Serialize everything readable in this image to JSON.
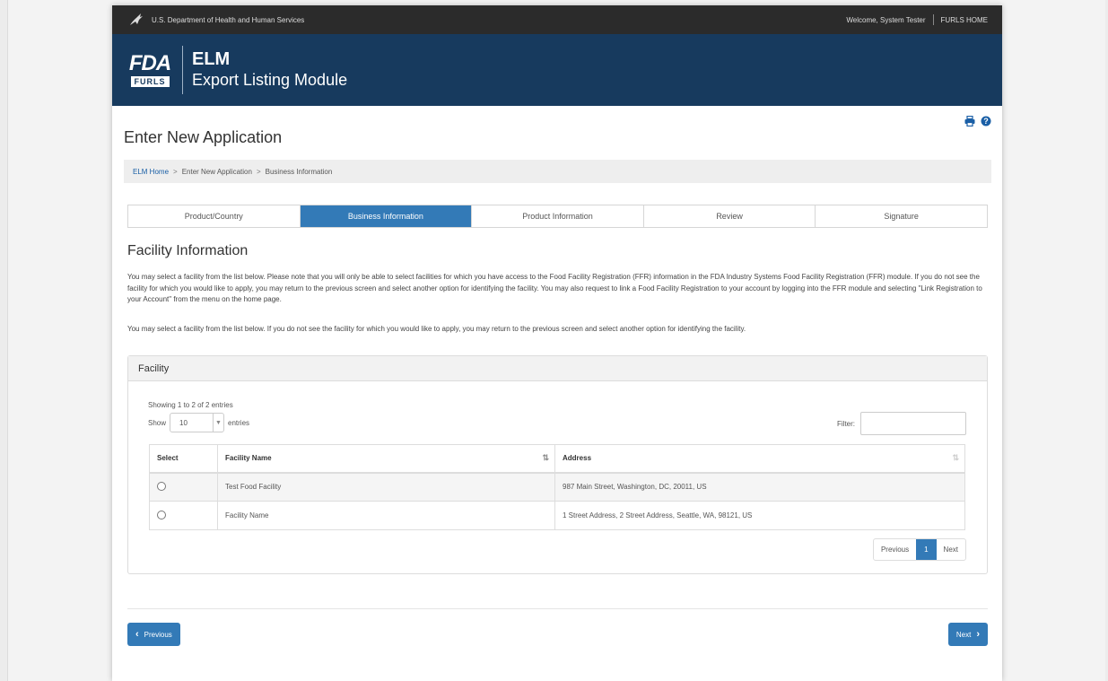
{
  "topbar": {
    "agency": "U.S. Department of Health and Human Services",
    "welcome": "Welcome, System Tester",
    "home_link": "FURLS HOME"
  },
  "banner": {
    "logo_text": "FDA",
    "logo_sub": "FURLS",
    "title": "ELM",
    "subtitle": "Export Listing Module"
  },
  "page_title": "Enter New Application",
  "breadcrumb": {
    "home": "ELM Home",
    "sep": ">",
    "item1": "Enter New Application",
    "item2": "Business Information"
  },
  "steps": [
    {
      "label": "Product/Country"
    },
    {
      "label": "Business Information"
    },
    {
      "label": "Product Information"
    },
    {
      "label": "Review"
    },
    {
      "label": "Signature"
    }
  ],
  "section_title": "Facility Information",
  "para1": "You may select a facility from the list below. Please note that you will only be able to select facilities for which you have access to the Food Facility Registration (FFR) information in the FDA Industry Systems Food Facility Registration (FFR) module. If you do not see the facility for which you would like to apply, you may return to the previous screen and select another option for identifying the facility. You may also request to link a Food Facility Registration to your account by logging into the FFR module and selecting \"Link Registration to your Account\" from the menu on the home page.",
  "para2": "You may select a facility from the list below. If you do not see the facility for which you would like to apply, you may return to the previous screen and select another option for identifying the facility.",
  "panel": {
    "title": "Facility",
    "showing": "Showing 1 to 2 of 2 entries",
    "show_label": "Show",
    "page_length": "10",
    "entries_label": "entries",
    "filter_label": "Filter:",
    "filter_value": ""
  },
  "table": {
    "headers": [
      "Select",
      "Facility Name",
      "Address"
    ],
    "rows": [
      {
        "name": "Test Food Facility",
        "address": "987 Main Street, Washington, DC, 20011, US"
      },
      {
        "name": "Facility Name",
        "address": "1 Street Address, 2 Street Address, Seattle, WA, 98121, US"
      }
    ]
  },
  "pager": {
    "previous": "Previous",
    "page": "1",
    "next": "Next"
  },
  "buttons": {
    "previous": "Previous",
    "next": "Next"
  },
  "icons": {
    "print": "print-icon",
    "help": "help-icon",
    "eagle": "hhs-eagle-icon"
  }
}
